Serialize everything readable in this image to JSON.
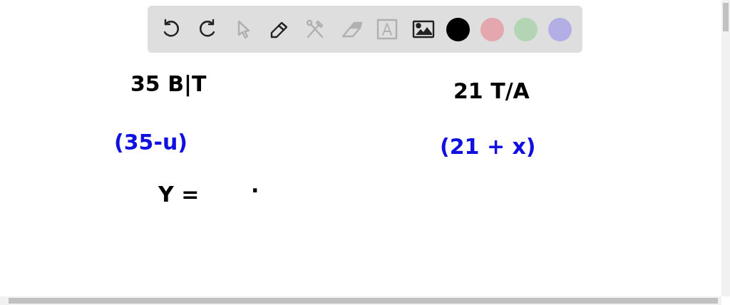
{
  "toolbar": {
    "tools": [
      {
        "kind": "undo",
        "disabled": false
      },
      {
        "kind": "redo",
        "disabled": false
      },
      {
        "kind": "select",
        "disabled": true
      },
      {
        "kind": "pen",
        "disabled": false
      },
      {
        "kind": "tools",
        "disabled": true
      },
      {
        "kind": "eraser",
        "disabled": true
      },
      {
        "kind": "text",
        "disabled": true
      },
      {
        "kind": "image",
        "disabled": false
      }
    ],
    "colors": [
      {
        "color": "#000000"
      },
      {
        "color": "#e4a7ae"
      },
      {
        "color": "#b3d5b3"
      },
      {
        "color": "#b3aee6"
      }
    ]
  },
  "notes": [
    {
      "text": "35  B|T",
      "color": "#000000"
    },
    {
      "text": "(35-u)",
      "color": "#1010e0"
    },
    {
      "text": "Y =",
      "color": "#000000"
    },
    {
      "text": "·",
      "color": "#000000"
    },
    {
      "text": "21 T/A",
      "color": "#000000"
    },
    {
      "text": "(21 + x)",
      "color": "#1010e0"
    }
  ]
}
